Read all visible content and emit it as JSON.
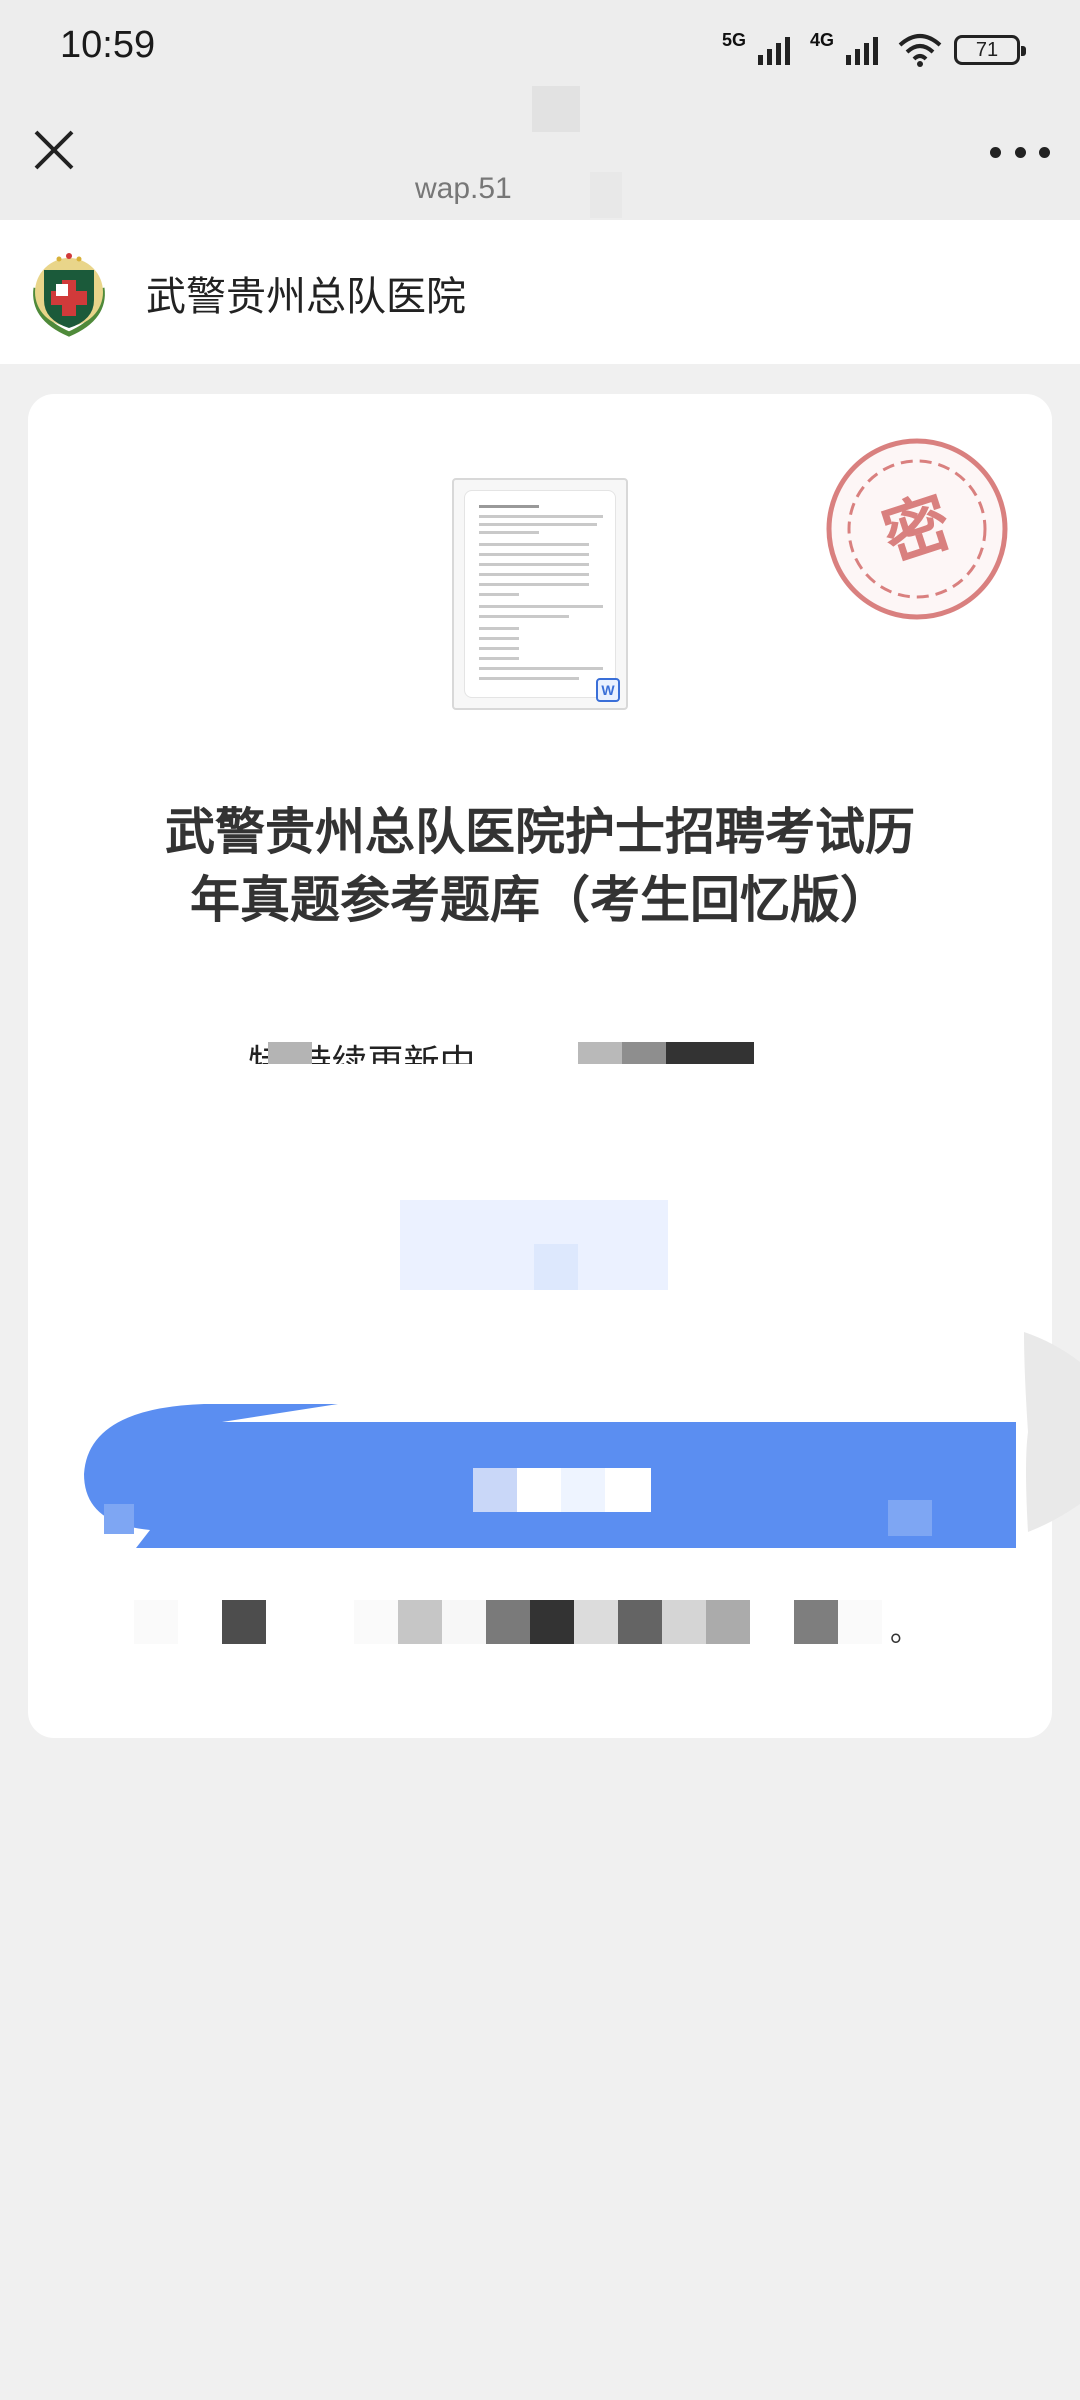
{
  "status_bar": {
    "time": "10:59",
    "network_1": "5G",
    "network_2": "4G",
    "battery": "71",
    "icons": [
      "signal-icon",
      "signal-icon",
      "wifi-icon",
      "battery-icon"
    ]
  },
  "nav": {
    "url": "wap.51",
    "close_icon": "close-icon",
    "more_icon": "more-icon"
  },
  "account": {
    "name": "武警贵州总队医院",
    "logo": "hospital-emblem"
  },
  "document": {
    "file_icon": "word-doc-icon",
    "badge": "W",
    "stamp": "密",
    "title": "武警贵州总队医院护士招聘考试历年真题参考题库（考生回忆版）",
    "update_text": "特      持续更新中",
    "note_tail": "。"
  },
  "colors": {
    "primary_blue": "#5b8ef1",
    "stamp_red": "#d9807f",
    "light_blue": "#ebf1ff"
  }
}
